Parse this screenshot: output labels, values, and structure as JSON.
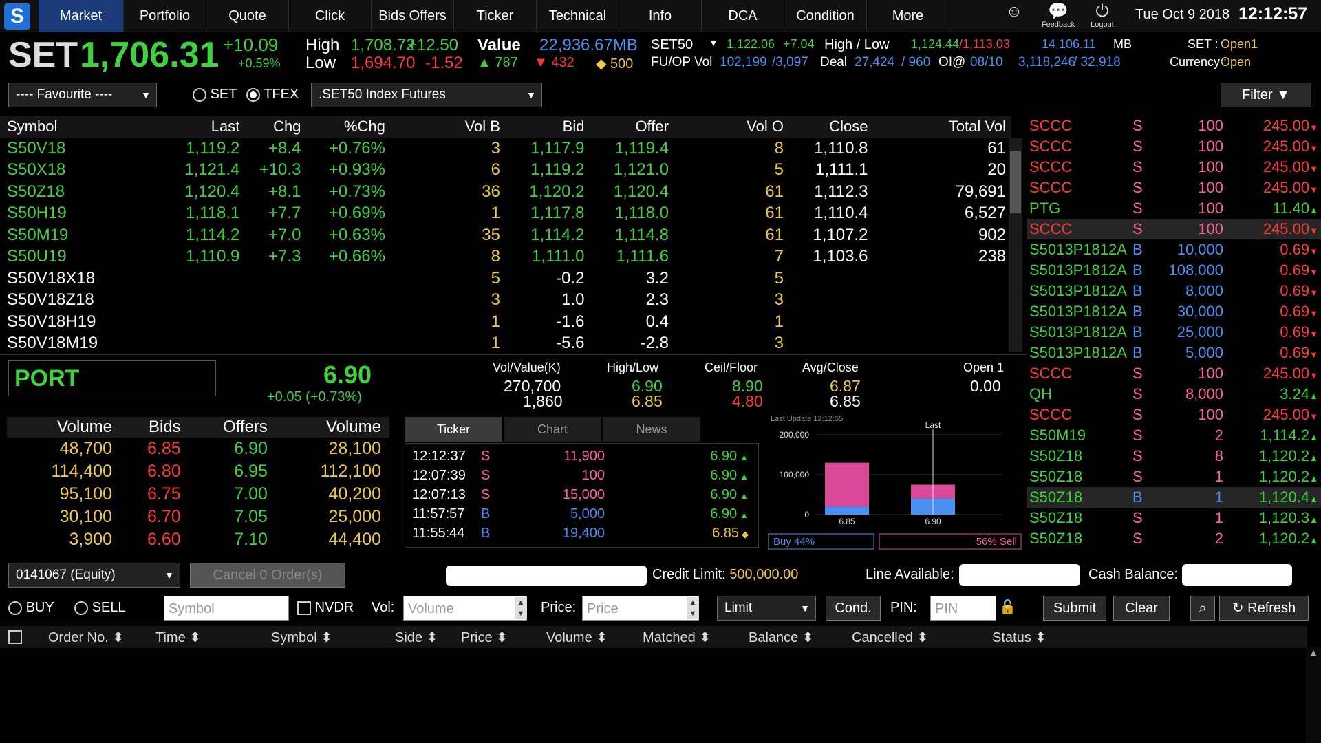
{
  "nav": {
    "logo": "S",
    "tabs": [
      "Market",
      "Portfolio",
      "Quote",
      "Click",
      "Bids Offers",
      "Ticker",
      "Technical",
      "Info",
      "DCA",
      "Condition",
      "More"
    ],
    "feedback": "Feedback",
    "logout": "Logout",
    "date": "Tue Oct 9 2018",
    "time": "12:12:57"
  },
  "index": {
    "name": "SET",
    "value": "1,706.31",
    "chg": "+10.09",
    "pct": "+0.59%",
    "high_label": "High",
    "high": "1,708.72",
    "high_chg": "+12.50",
    "low_label": "Low",
    "low": "1,694.70",
    "low_chg": "-1.52",
    "value_label": "Value",
    "value_amt": "22,936.67MB",
    "up": "787",
    "down": "432",
    "unch": "500",
    "set50_label": "SET50",
    "set50": "1,122.06",
    "set50_chg": "+7.04",
    "hl_label": "High / Low",
    "set50_high": "1,124.44",
    "set50_low": "1,113.03",
    "set50_val": "14,106.11",
    "mb": "MB",
    "set_status_label": "SET :",
    "set_status": "Open1",
    "fuop_label": "FU/OP Vol",
    "fuop_vol1": "102,199",
    "fuop_vol2": "/3,097",
    "deal_label": "Deal",
    "deal1": "27,424",
    "deal2": "/ 960",
    "oi_label": "OI@",
    "oi_date": "08/10",
    "oi1": "3,118,246",
    "oi2": "/ 32,918",
    "currency_label": "Currency :",
    "currency": "Open"
  },
  "controls": {
    "favourite": "---- Favourite ----",
    "radio_set": "SET",
    "radio_tfex": "TFEX",
    "series": ".SET50 Index Futures",
    "filter": "Filter"
  },
  "market": {
    "headers": [
      "Symbol",
      "Last",
      "Chg",
      "%Chg",
      "Vol B",
      "Bid",
      "Offer",
      "Vol O",
      "Close",
      "Total Vol"
    ],
    "rows": [
      [
        "S50V18",
        "1,119.2",
        "+8.4",
        "+0.76%",
        "3",
        "1,117.9",
        "1,119.4",
        "8",
        "1,110.8",
        "61"
      ],
      [
        "S50X18",
        "1,121.4",
        "+10.3",
        "+0.93%",
        "6",
        "1,119.2",
        "1,121.0",
        "5",
        "1,111.1",
        "20"
      ],
      [
        "S50Z18",
        "1,120.4",
        "+8.1",
        "+0.73%",
        "36",
        "1,120.2",
        "1,120.4",
        "61",
        "1,112.3",
        "79,691"
      ],
      [
        "S50H19",
        "1,118.1",
        "+7.7",
        "+0.69%",
        "1",
        "1,117.8",
        "1,118.0",
        "61",
        "1,110.4",
        "6,527"
      ],
      [
        "S50M19",
        "1,114.2",
        "+7.0",
        "+0.63%",
        "35",
        "1,114.2",
        "1,114.8",
        "61",
        "1,107.2",
        "902"
      ],
      [
        "S50U19",
        "1,110.9",
        "+7.3",
        "+0.66%",
        "8",
        "1,111.0",
        "1,111.6",
        "7",
        "1,103.6",
        "238"
      ],
      [
        "S50V18X18",
        "",
        "",
        "",
        "5",
        "-0.2",
        "3.2",
        "5",
        "",
        ""
      ],
      [
        "S50V18Z18",
        "",
        "",
        "",
        "3",
        "1.0",
        "2.3",
        "3",
        "",
        ""
      ],
      [
        "S50V18H19",
        "",
        "",
        "",
        "1",
        "-1.6",
        "0.4",
        "1",
        "",
        ""
      ],
      [
        "S50V18M19",
        "",
        "",
        "",
        "1",
        "-5.6",
        "-2.8",
        "3",
        "",
        ""
      ]
    ]
  },
  "ticker_side": [
    {
      "sym": "SCCC",
      "side": "S",
      "vol": "100",
      "price": "245.00",
      "dir": "▼",
      "c": "r"
    },
    {
      "sym": "SCCC",
      "side": "S",
      "vol": "100",
      "price": "245.00",
      "dir": "▼",
      "c": "r"
    },
    {
      "sym": "SCCC",
      "side": "S",
      "vol": "100",
      "price": "245.00",
      "dir": "▼",
      "c": "r"
    },
    {
      "sym": "SCCC",
      "side": "S",
      "vol": "100",
      "price": "245.00",
      "dir": "▼",
      "c": "r"
    },
    {
      "sym": "PTG",
      "side": "S",
      "vol": "100",
      "price": "11.40",
      "dir": "▲",
      "c": "g"
    },
    {
      "sym": "SCCC",
      "side": "S",
      "vol": "100",
      "price": "245.00",
      "dir": "▼",
      "c": "r",
      "hl": true
    },
    {
      "sym": "S5013P1812A",
      "side": "B",
      "vol": "10,000",
      "price": "0.69",
      "dir": "▼",
      "c": "r"
    },
    {
      "sym": "S5013P1812A",
      "side": "B",
      "vol": "108,000",
      "price": "0.69",
      "dir": "▼",
      "c": "r"
    },
    {
      "sym": "S5013P1812A",
      "side": "B",
      "vol": "8,000",
      "price": "0.69",
      "dir": "▼",
      "c": "r"
    },
    {
      "sym": "S5013P1812A",
      "side": "B",
      "vol": "30,000",
      "price": "0.69",
      "dir": "▼",
      "c": "r"
    },
    {
      "sym": "S5013P1812A",
      "side": "B",
      "vol": "25,000",
      "price": "0.69",
      "dir": "▼",
      "c": "r"
    },
    {
      "sym": "S5013P1812A",
      "side": "B",
      "vol": "5,000",
      "price": "0.69",
      "dir": "▼",
      "c": "r"
    },
    {
      "sym": "SCCC",
      "side": "S",
      "vol": "100",
      "price": "245.00",
      "dir": "▼",
      "c": "r"
    },
    {
      "sym": "QH",
      "side": "S",
      "vol": "8,000",
      "price": "3.24",
      "dir": "▲",
      "c": "g"
    },
    {
      "sym": "SCCC",
      "side": "S",
      "vol": "100",
      "price": "245.00",
      "dir": "▼",
      "c": "r"
    },
    {
      "sym": "S50M19",
      "side": "S",
      "vol": "2",
      "price": "1,114.2",
      "dir": "▲",
      "c": "g"
    },
    {
      "sym": "S50Z18",
      "side": "S",
      "vol": "8",
      "price": "1,120.2",
      "dir": "▲",
      "c": "g"
    },
    {
      "sym": "S50Z18",
      "side": "S",
      "vol": "1",
      "price": "1,120.2",
      "dir": "▲",
      "c": "g"
    },
    {
      "sym": "S50Z18",
      "side": "B",
      "vol": "1",
      "price": "1,120.4",
      "dir": "▲",
      "c": "g",
      "hl": true
    },
    {
      "sym": "S50Z18",
      "side": "S",
      "vol": "1",
      "price": "1,120.3",
      "dir": "▲",
      "c": "g"
    },
    {
      "sym": "S50Z18",
      "side": "S",
      "vol": "2",
      "price": "1,120.2",
      "dir": "▲",
      "c": "g"
    }
  ],
  "port": {
    "symbol": "PORT",
    "last": "6.90",
    "chg": "+0.05 (+0.73%)",
    "volval_label": "Vol/Value(K)",
    "vol": "270,700",
    "val": "1,860",
    "hl_label": "High/Low",
    "high": "6.90",
    "low": "6.85",
    "cf_label": "Ceil/Floor",
    "ceil": "8.90",
    "floor": "4.80",
    "ac_label": "Avg/Close",
    "avg": "6.87",
    "close": "6.85",
    "open_label": "Open 1",
    "open": "0.00"
  },
  "book": {
    "headers": [
      "Volume",
      "Bids",
      "Offers",
      "Volume"
    ],
    "rows": [
      [
        "48,700",
        "6.85",
        "6.90",
        "28,100"
      ],
      [
        "114,400",
        "6.80",
        "6.95",
        "112,100"
      ],
      [
        "95,100",
        "6.75",
        "7.00",
        "40,200"
      ],
      [
        "30,100",
        "6.70",
        "7.05",
        "25,000"
      ],
      [
        "3,900",
        "6.60",
        "7.10",
        "44,400"
      ]
    ]
  },
  "subtabs": [
    "Ticker",
    "Chart",
    "News"
  ],
  "trades": [
    [
      "12:12:37",
      "S",
      "11,900",
      "6.90",
      "▲"
    ],
    [
      "12:07:39",
      "S",
      "100",
      "6.90",
      "▲"
    ],
    [
      "12:07:13",
      "S",
      "15,000",
      "6.90",
      "▲"
    ],
    [
      "11:57:57",
      "B",
      "5,000",
      "6.90",
      "▲"
    ],
    [
      "11:55:44",
      "B",
      "19,400",
      "6.85",
      "◆"
    ]
  ],
  "chart_data": {
    "type": "bar",
    "title": "Last Update 12:12:55",
    "categories": [
      "6.85",
      "6.90"
    ],
    "series": [
      {
        "values": [
          20000,
          40000
        ],
        "color": "#4a8ef0"
      },
      {
        "values": [
          110000,
          35000
        ],
        "color": "#d94b98"
      }
    ],
    "ylim": [
      0,
      200000
    ],
    "yticks": [
      "200,000",
      "100,000",
      "0"
    ],
    "marker_label": "Last",
    "buy": "Buy 44%",
    "sell": "56% Sell"
  },
  "order": {
    "account": "0141067 (Equity)",
    "cancel": "Cancel 0 Order(s)",
    "credit_label": "Credit Limit:",
    "credit": "500,000.00",
    "line_label": "Line Available:",
    "cash_label": "Cash Balance:",
    "buy": "BUY",
    "sell": "SELL",
    "symbol_ph": "Symbol",
    "nvdr": "NVDR",
    "vol_label": "Vol:",
    "vol_ph": "Volume",
    "price_label": "Price:",
    "price_ph": "Price",
    "type": "Limit",
    "cond": "Cond.",
    "pin_label": "PIN:",
    "pin_ph": "PIN",
    "submit": "Submit",
    "clear": "Clear",
    "refresh": "Refresh",
    "headers": [
      "Order No.",
      "Time",
      "Symbol",
      "Side",
      "Price",
      "Volume",
      "Matched",
      "Balance",
      "Cancelled",
      "Status"
    ]
  }
}
